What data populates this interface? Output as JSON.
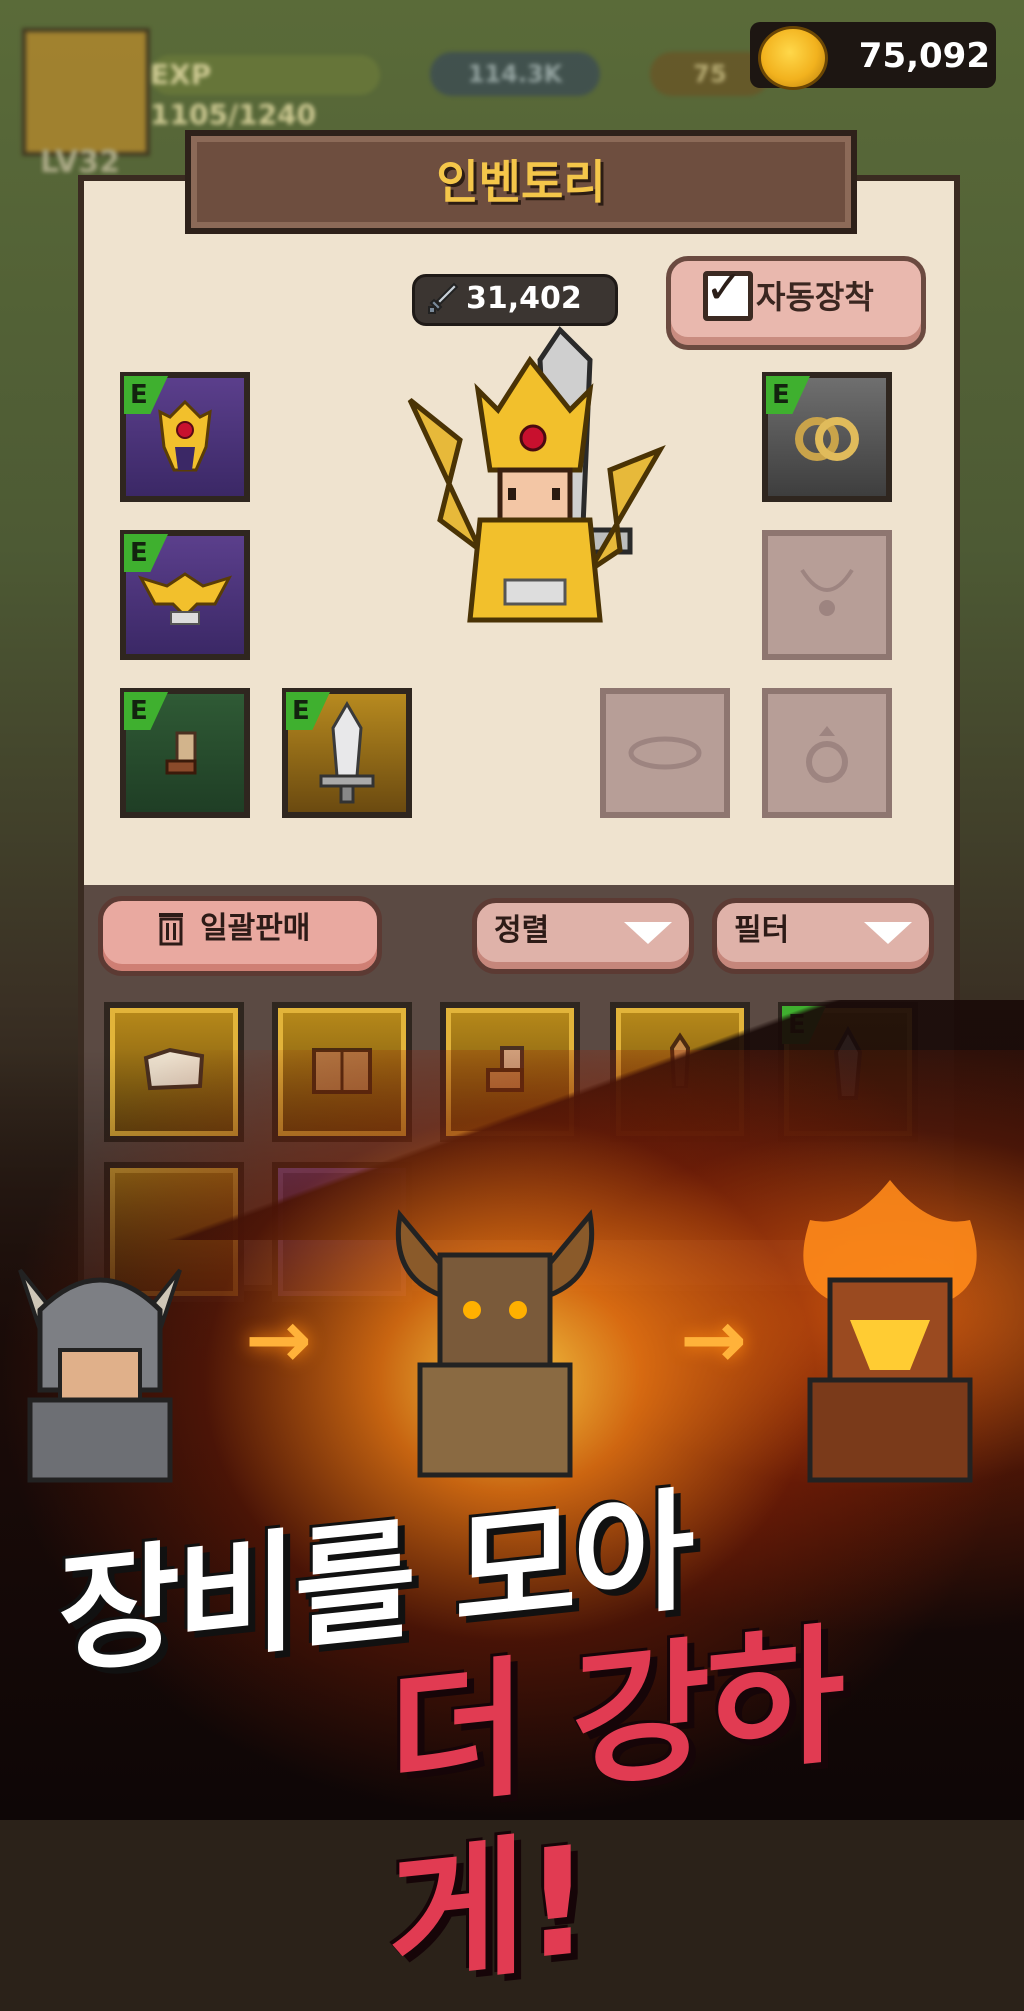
{
  "hud": {
    "level": "LV32",
    "exp_label": "EXP",
    "exp_value": "1105/1240",
    "gems": "114.3K",
    "gold_partial": "75",
    "gold": "75,092"
  },
  "inventory": {
    "title": "인벤토리",
    "power": "31,402",
    "auto_equip_label": "자동장착",
    "auto_equip_checked": true,
    "grade_badge": "E",
    "bulk_sell_label": "일괄판매",
    "sort_label": "정렬",
    "filter_label": "필터"
  },
  "promo": {
    "line1": "장비를 모아",
    "line2": "더 강하게!"
  },
  "colors": {
    "gold_text": "#f4c64a",
    "accent_red": "#e13b52",
    "panel_bg": "#efe3cf",
    "grade_green": "#3fb02f"
  }
}
